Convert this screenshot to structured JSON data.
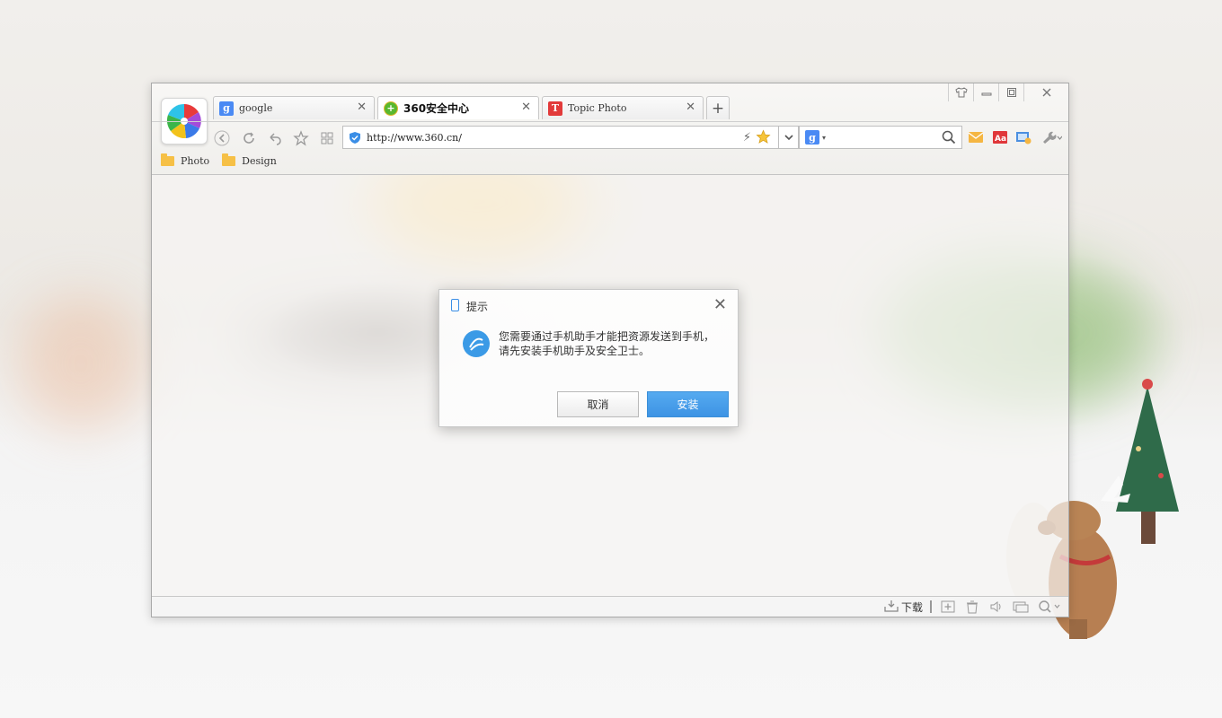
{
  "window": {
    "controls": [
      "skin-icon",
      "minimize-icon",
      "restore-icon",
      "close-icon"
    ]
  },
  "tabs": [
    {
      "label": "google",
      "favicon": "google-g-icon",
      "favicon_color": "#4a8af4",
      "favicon_glyph": "g",
      "active": false
    },
    {
      "label": "360安全中心",
      "favicon": "360-plus-icon",
      "favicon_color": "#59b82f",
      "favicon_glyph": "+",
      "active": true
    },
    {
      "label": "Topic Photo",
      "favicon": "topic-t-icon",
      "favicon_color": "#e23a3a",
      "favicon_glyph": "T",
      "active": false
    }
  ],
  "new_tab_label": "+",
  "address_bar": {
    "url": "http://www.360.cn/"
  },
  "search_bar": {
    "engine_icon": "google-g-icon",
    "engine_glyph": "g"
  },
  "bookmarks": [
    {
      "label": "Photo"
    },
    {
      "label": "Design"
    }
  ],
  "status_bar": {
    "download_label": "下载"
  },
  "dialog": {
    "title": "提示",
    "message_line1": "您需要通过手机助手才能把资源发送到手机，",
    "message_line2": "请先安装手机助手及安全卫士。",
    "cancel_label": "取消",
    "ok_label": "安装"
  },
  "colors": {
    "accent_blue": "#3d93e4",
    "folder_yellow": "#f6c046"
  }
}
